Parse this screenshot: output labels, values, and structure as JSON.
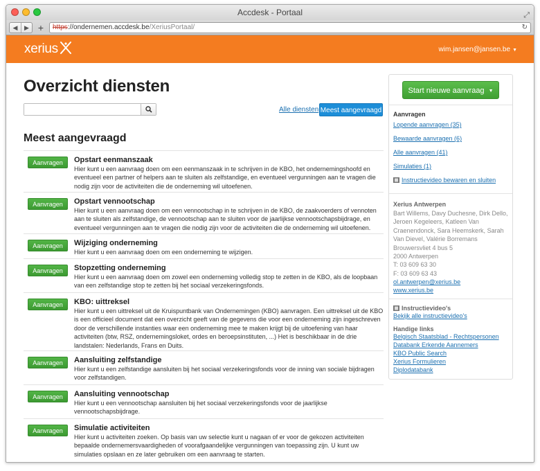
{
  "window": {
    "title": "Accdesk - Portaal"
  },
  "browser": {
    "url_scheme": "https",
    "url_rest": "://ondernemen.accdesk.be",
    "url_path": "/XeriusPortaal/"
  },
  "header": {
    "logo_text": "xerius",
    "user": "wim.jansen@jansen.be"
  },
  "page": {
    "title": "Overzicht diensten",
    "search_placeholder": "",
    "all_services_link": "Alle diensten",
    "most_requested_button": "Meest aangevraagd",
    "section_title": "Meest aangevraagd",
    "request_label": "Aanvragen"
  },
  "services": [
    {
      "title": "Opstart eenmanszaak",
      "desc": "Hier kunt u een aanvraag doen om een eenmanszaak in te schrijven in de KBO, het ondernemingshoofd en eventueel een partner of helpers aan te sluiten als zelfstandige, en eventueel vergunningen aan te vragen die nodig zijn voor de activiteiten die de onderneming wil uitoefenen."
    },
    {
      "title": "Opstart vennootschap",
      "desc": "Hier kunt u een aanvraag doen om een vennootschap in te schrijven in de KBO, de zaakvoerders of vennoten aan te sluiten als zelfstandige, de vennootschap aan te sluiten voor de jaarlijkse vennootschapsbijdrage, en eventueel vergunningen aan te vragen die nodig zijn voor de activiteiten die de onderneming wil uitoefenen."
    },
    {
      "title": "Wijziging onderneming",
      "desc": "Hier kunt u een aanvraag doen om een onderneming te wijzigen."
    },
    {
      "title": "Stopzetting onderneming",
      "desc": "Hier kunt u een aanvraag doen om zowel een onderneming volledig stop te zetten in de KBO, als de loopbaan van een zelfstandige stop te zetten bij het sociaal verzekeringsfonds."
    },
    {
      "title": "KBO: uittreksel",
      "desc": "Hier kunt u een uittreksel uit de Kruispuntbank van Ondernemingen (KBO) aanvragen. Een uittreksel uit de KBO is een officieel document dat een overzicht geeft van de gegevens die voor een onderneming zijn ingeschreven door de verschillende instanties waar een onderneming mee te maken krijgt bij de uitoefening van haar activiteiten (btw, RSZ, ondernemingsloket, ordes en beroepsinstituten, ...) Het is beschikbaar in de drie landstalen: Nederlands, Frans en Duits."
    },
    {
      "title": "Aansluiting zelfstandige",
      "desc": "Hier kunt u een zelfstandige aansluiten bij het sociaal verzekeringsfonds voor de inning van sociale bijdragen voor zelfstandigen."
    },
    {
      "title": "Aansluiting vennootschap",
      "desc": "Hier kunt u een vennootschap aansluiten bij het sociaal verzekeringsfonds voor de jaarlijkse vennootschapsbijdrage."
    },
    {
      "title": "Simulatie activiteiten",
      "desc": "Hier kunt u activiteiten zoeken. Op basis van uw selectie kunt u nagaan of er voor de gekozen activiteiten bepaalde ondernemersvaardigheden of voorafgaandelijke vergunningen van toepassing zijn. U kunt uw simulaties opslaan en ze later gebruiken om een aanvraag te starten."
    }
  ],
  "sidebar": {
    "start_button": "Start nieuwe aanvraag",
    "requests_heading": "Aanvragen",
    "links": [
      "Lopende aanvragen (35)",
      "Bewaarde aanvragen (6)",
      "Alle aanvragen (41)",
      "Simulaties (1)"
    ],
    "video_link": "Instructievideo bewaren en sluiten",
    "office_name": "Xerius Antwerpen",
    "office_people": "Bart Willems, Davy Duchesne, Dirk Dello, Jeroen Kegeleers, Katleen Van Craenendonck, Sara Heemskerk, Sarah Van Dievel, Valérie Borremans",
    "address_line1": "Brouwersvliet 4 bus 5",
    "address_line2": "2000 Antwerpen",
    "phone": "T: 03 609 63 30",
    "fax": "F: 03 609 63 43",
    "email": "ol.antwerpen@xerius.be",
    "website": "www.xerius.be",
    "videos_heading": "Instructievideo's",
    "videos_link": "Bekijk alle instructievideo's",
    "handy_heading": "Handige links",
    "handy_links": [
      "Belgisch Staatsblad - Rechtspersonen",
      "Databank Erkende Aannemers",
      "KBO Public Search",
      "Xerius Formulieren",
      "Diplodatabank"
    ]
  },
  "colors": {
    "brand_orange": "#f47c20",
    "green": "#4aa83d",
    "blue": "#1d8ed8",
    "link": "#1a6fb0"
  }
}
